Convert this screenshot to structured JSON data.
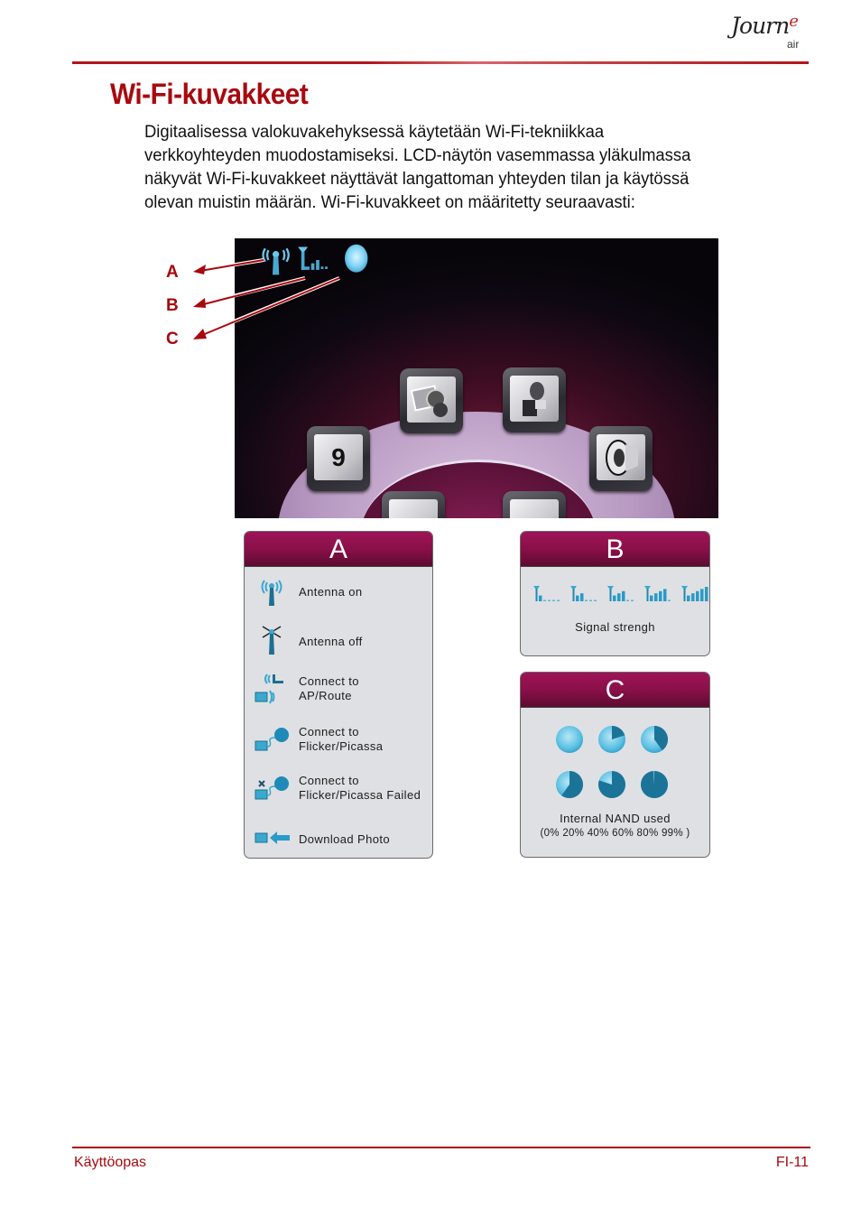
{
  "header": {
    "logo": {
      "script": "Journ",
      "accent": "e",
      "sub": "air"
    }
  },
  "section": {
    "title": "Wi-Fi-kuvakkeet",
    "paragraph_lines": [
      "Digitaalisessa valokuvakehyksessä käytetään Wi-Fi-tekniikkaa",
      "verkkoyhteyden muodostamiseksi. LCD-näytön vasemmassa yläkulmassa",
      "näkyvät Wi-Fi-kuvakkeet näyttävät langattoman yhteyden tilan ja käytössä",
      "olevan muistin määrän. Wi-Fi-kuvakkeet on määritetty seuraavasti:"
    ]
  },
  "figure": {
    "callouts": [
      "A",
      "B",
      "C"
    ],
    "lcd": {
      "status_icons": [
        "antenna-icon",
        "signal-strength-icon",
        "storage-disc-icon"
      ],
      "menu_tiles": [
        {
          "icon": "photo-music-icon",
          "text": ""
        },
        {
          "icon": "video-camera-icon",
          "text": ""
        },
        {
          "icon": "calendar-icon",
          "text": "9"
        },
        {
          "icon": "speaker-icon",
          "text": ""
        },
        {
          "icon": "tile-partial-icon",
          "text": ""
        },
        {
          "icon": "tile-partial-icon",
          "text": ""
        }
      ]
    }
  },
  "panels": {
    "a": {
      "header": "A",
      "items": [
        {
          "icon": "antenna-on-icon",
          "lines": [
            "Antenna on"
          ]
        },
        {
          "icon": "antenna-off-icon",
          "lines": [
            "Antenna off"
          ]
        },
        {
          "icon": "connect-ap-icon",
          "lines": [
            "Connect to",
            "AP/Route"
          ]
        },
        {
          "icon": "connect-flicker-icon",
          "lines": [
            "Connect to",
            "Flicker/Picassa"
          ]
        },
        {
          "icon": "connect-failed-icon",
          "lines": [
            "Connect to",
            "Flicker/Picassa Failed"
          ]
        },
        {
          "icon": "download-photo-icon",
          "lines": [
            "Download Photo"
          ]
        }
      ]
    },
    "b": {
      "header": "B",
      "signal_levels": [
        1,
        2,
        3,
        4,
        5
      ],
      "signal_max": 5,
      "caption": "Signal strengh"
    },
    "c": {
      "header": "C",
      "usage_levels_percent": [
        0,
        20,
        40,
        60,
        80,
        99
      ],
      "caption": "Internal NAND used",
      "sub_caption": "(0% 20% 40% 60% 80% 99% )"
    }
  },
  "footer": {
    "left": "Käyttöopas",
    "right": "FI-11"
  },
  "colors": {
    "brand_red": "#a8090f",
    "panel_header": "#8a1049",
    "icon_blue": "#3aa8cf",
    "icon_dark_blue": "#1d6f8f"
  }
}
